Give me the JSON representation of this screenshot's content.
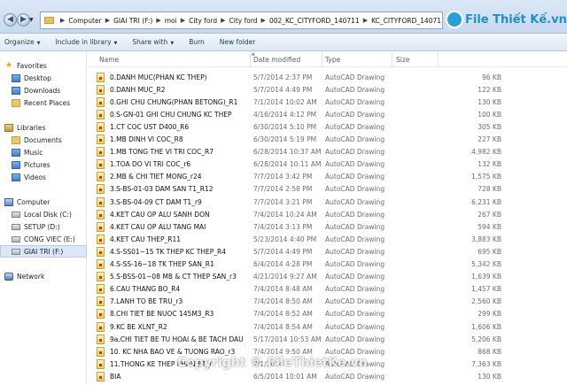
{
  "address": {
    "crumbs": [
      "Computer",
      "GIAI TRI (F:)",
      "moi",
      "City ford",
      "City ford",
      "002_KC_CITYFORD_140711",
      "KC_CITYFORD_140711"
    ]
  },
  "logo": {
    "text": "File Thiết Kế",
    "suffix": ".vn"
  },
  "toolbar": {
    "organize": "Organize",
    "include": "Include in library",
    "share": "Share with",
    "burn": "Burn",
    "new_folder": "New folder"
  },
  "sidebar": {
    "favorites": "Favorites",
    "desktop": "Desktop",
    "downloads": "Downloads",
    "recent": "Recent Places",
    "libraries": "Libraries",
    "documents": "Documents",
    "music": "Music",
    "pictures": "Pictures",
    "videos": "Videos",
    "computer": "Computer",
    "local_disk": "Local Disk (C:)",
    "setup": "SETUP (D:)",
    "cong_viec": "CONG VIEC (E:)",
    "giai_tri": "GIAI TRI (F:)",
    "network": "Network"
  },
  "columns": {
    "name": "Name",
    "date": "Date modified",
    "type": "Type",
    "size": "Size"
  },
  "files": [
    {
      "name": "0.DANH MUC(PHAN KC THEP)",
      "date": "5/7/2014 2:37 PM",
      "type": "AutoCAD Drawing",
      "size": "96 KB"
    },
    {
      "name": "0.DANH MUC_R2",
      "date": "5/7/2014 4:49 PM",
      "type": "AutoCAD Drawing",
      "size": "122 KB"
    },
    {
      "name": "0.GHI CHU CHUNG(PHAN BETONG)_R1",
      "date": "7/1/2014 10:02 AM",
      "type": "AutoCAD Drawing",
      "size": "130 KB"
    },
    {
      "name": "0.S-GN-01 GHI CHU CHUNG KC THEP",
      "date": "4/16/2014 4:12 PM",
      "type": "AutoCAD Drawing",
      "size": "100 KB"
    },
    {
      "name": "1.CT COC UST D400_R6",
      "date": "6/30/2014 5:10 PM",
      "type": "AutoCAD Drawing",
      "size": "305 KB"
    },
    {
      "name": "1.MB DINH VI COC_R8",
      "date": "6/30/2014 5:19 PM",
      "type": "AutoCAD Drawing",
      "size": "227 KB"
    },
    {
      "name": "1.MB TONG THE VI TRI COC_R7",
      "date": "6/28/2014 10:37 AM",
      "type": "AutoCAD Drawing",
      "size": "4,982 KB"
    },
    {
      "name": "1.TOA DO VI TRI COC_r6",
      "date": "6/28/2014 10:11 AM",
      "type": "AutoCAD Drawing",
      "size": "132 KB"
    },
    {
      "name": "2.MB & CHI TIET MONG_r24",
      "date": "7/7/2014 3:42 PM",
      "type": "AutoCAD Drawing",
      "size": "1,575 KB"
    },
    {
      "name": "3.S-BS-01-03 DAM SAN T1_R12",
      "date": "7/7/2014 2:58 PM",
      "type": "AutoCAD Drawing",
      "size": "728 KB"
    },
    {
      "name": "3.S-BS-04-09 CT DAM T1_r9",
      "date": "7/7/2014 3:21 PM",
      "type": "AutoCAD Drawing",
      "size": "6,231 KB"
    },
    {
      "name": "4.KET CAU OP ALU SANH DON",
      "date": "7/4/2014 10:24 AM",
      "type": "AutoCAD Drawing",
      "size": "267 KB"
    },
    {
      "name": "4.KET CAU OP ALU TANG MAI",
      "date": "7/4/2014 3:13 PM",
      "type": "AutoCAD Drawing",
      "size": "594 KB"
    },
    {
      "name": "4.KET CAU THEP_R11",
      "date": "5/23/2014 4:40 PM",
      "type": "AutoCAD Drawing",
      "size": "3,883 KB"
    },
    {
      "name": "4.S-SS01~15 TK THEP KC THEP_R4",
      "date": "5/7/2014 4:49 PM",
      "type": "AutoCAD Drawing",
      "size": "695 KB"
    },
    {
      "name": "4.S-SS-16~18 TK THEP SAN_R1",
      "date": "6/4/2014 4:28 PM",
      "type": "AutoCAD Drawing",
      "size": "5,342 KB"
    },
    {
      "name": "5.S-BSS-01~08 MB & CT THEP SAN_r3",
      "date": "4/21/2014 9:27 AM",
      "type": "AutoCAD Drawing",
      "size": "1,639 KB"
    },
    {
      "name": "6.CAU THANG BO_R4",
      "date": "7/4/2014 8:48 AM",
      "type": "AutoCAD Drawing",
      "size": "1,457 KB"
    },
    {
      "name": "7.LANH TO BE TRU_r3",
      "date": "7/4/2014 8:50 AM",
      "type": "AutoCAD Drawing",
      "size": "2,560 KB"
    },
    {
      "name": "8.CHI TIET BE NUOC 145M3_R3",
      "date": "7/4/2014 8:52 AM",
      "type": "AutoCAD Drawing",
      "size": "299 KB"
    },
    {
      "name": "9.KC BE XLNT_R2",
      "date": "7/4/2014 8:54 AM",
      "type": "AutoCAD Drawing",
      "size": "1,606 KB"
    },
    {
      "name": "9a.CHI TIET BE TU HOAI & BE TACH DAU",
      "date": "5/17/2014 10:53 AM",
      "type": "AutoCAD Drawing",
      "size": "5,206 KB"
    },
    {
      "name": "10. KC NHA BAO VE & TUONG RAO_r3",
      "date": "7/4/2014 9:50 AM",
      "type": "AutoCAD Drawing",
      "size": "868 KB"
    },
    {
      "name": "11.THONG KE THEP PHAN ET_r",
      "date": "7/1/2014",
      "type": "AutoCAD Drawing",
      "size": "7,363 KB"
    },
    {
      "name": "BIA",
      "date": "6/5/2014 10:01 AM",
      "type": "AutoCAD Drawing",
      "size": "130 KB"
    }
  ],
  "watermark": "Copyright © FileThietKe.vn"
}
